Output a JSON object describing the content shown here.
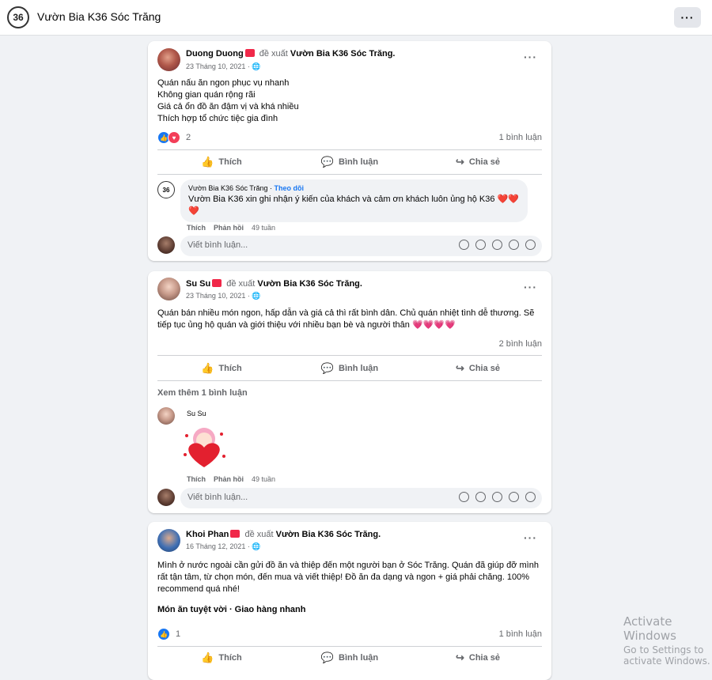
{
  "header": {
    "page_name": "Vườn Bia K36 Sóc Trăng",
    "logo_text": "36",
    "more_label": "···"
  },
  "posts": [
    {
      "author": "Duong Duong",
      "recommends": "đề xuất",
      "target": "Vườn Bia K36 Sóc Trăng.",
      "date": "23 Tháng 10, 2021 · ",
      "lines": [
        "Quán nấu ăn ngon phục vụ nhanh",
        "Không gian quán rộng rãi",
        "Giá cả ổn đồ ăn đậm vị và khá nhiều",
        "Thích hợp tổ chức tiệc gia đình"
      ],
      "reaction_count": "2",
      "comment_count": "1 bình luận",
      "comment": {
        "author": "Vườn Bia K36 Sóc Trăng",
        "follow": "Theo dõi",
        "text": "Vườn Bia K36 xin ghi nhận ý kiến của khách và cảm ơn khách luôn ủng hộ K36 ❤️❤️ ❤️",
        "time": "49 tuần"
      }
    },
    {
      "author": "Su Su",
      "recommends": "đề xuất",
      "target": "Vườn Bia K36 Sóc Trăng.",
      "date": "23 Tháng 10, 2021 · ",
      "lines": [
        "Quán bán nhiều món ngon, hấp dẫn và giá cả thì  rất bình dân. Chủ quán nhiệt tình dễ thương. Sẽ tiếp tục ủng hộ quán và giới thiệu với nhiều bạn bè và người thân 💗💗💗💗"
      ],
      "comment_count": "2 bình luận",
      "see_more": "Xem thêm 1 bình luận",
      "comment": {
        "author": "Su Su",
        "time": "49 tuần"
      }
    },
    {
      "author": "Khoi Phan",
      "recommends": "đề xuất",
      "target": "Vườn Bia K36 Sóc Trăng.",
      "date": "16 Tháng 12, 2021 · ",
      "lines": [
        "Mình ở nước ngoài cần gửi đồ ăn và thiệp đến một người bạn ở Sóc Trăng. Quán đã giúp đỡ mình rất tận tâm, từ chọn món, đến mua và viết thiệp! Đồ ăn đa dạng và ngon + giá phải chăng. 100% recommend quá nhé!"
      ],
      "tags": "Món ăn tuyệt vời · Giao hàng nhanh",
      "reaction_count": "1",
      "comment_count": "1 bình luận"
    }
  ],
  "actions": {
    "like": "Thích",
    "comment": "Bình luận",
    "share": "Chia sẻ"
  },
  "comment_actions": {
    "like": "Thích",
    "reply": "Phản hồi"
  },
  "comment_placeholder": "Viết bình luận...",
  "watermark": {
    "line1": "Activate Windows",
    "line2": "Go to Settings to activate Windows."
  }
}
